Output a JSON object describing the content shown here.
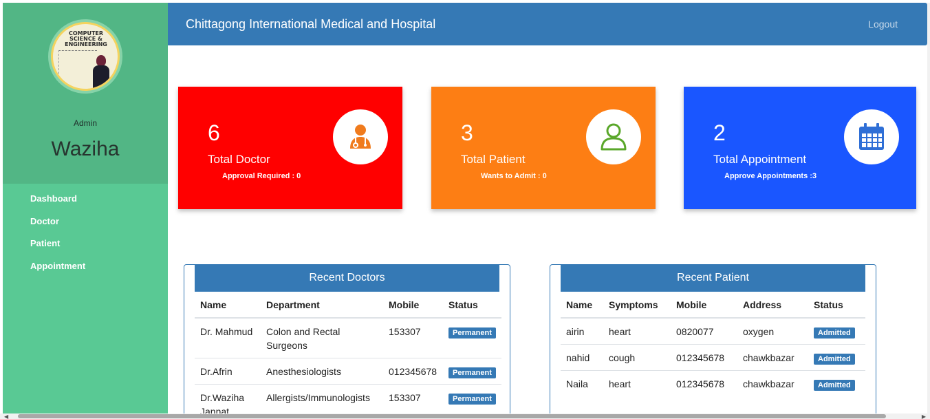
{
  "header": {
    "title": "Chittagong International Medical and Hospital",
    "logout_label": "Logout",
    "color": "#3579b5"
  },
  "sidebar": {
    "role": "Admin",
    "user_name": "Waziha",
    "avatar_text": "COMPUTER SCIENCE & ENGINEERING",
    "items": [
      {
        "label": "Dashboard"
      },
      {
        "label": "Doctor"
      },
      {
        "label": "Patient"
      },
      {
        "label": "Appointment"
      }
    ]
  },
  "cards": [
    {
      "value": "6",
      "label": "Total Doctor",
      "sub": "Approval Required : 0",
      "color": "#ff0000",
      "icon": "doctor-icon"
    },
    {
      "value": "3",
      "label": "Total Patient",
      "sub": "Wants to Admit : 0",
      "color": "#fd7e14",
      "icon": "user-icon"
    },
    {
      "value": "2",
      "label": "Total Appointment",
      "sub": "Approve Appointments :3",
      "color": "#1a56ff",
      "icon": "calendar-icon"
    }
  ],
  "recent_doctors": {
    "title": "Recent Doctors",
    "columns": [
      "Name",
      "Department",
      "Mobile",
      "Status"
    ],
    "rows": [
      {
        "name": "Dr. Mahmud",
        "department": "Colon and Rectal Surgeons",
        "mobile": "153307",
        "status": "Permanent"
      },
      {
        "name": "Dr.Afrin",
        "department": "Anesthesiologists",
        "mobile": "012345678",
        "status": "Permanent"
      },
      {
        "name": "Dr.Waziha Jannat",
        "department": "Allergists/Immunologists",
        "mobile": "153307",
        "status": "Permanent"
      }
    ]
  },
  "recent_patients": {
    "title": "Recent Patient",
    "columns": [
      "Name",
      "Symptoms",
      "Mobile",
      "Address",
      "Status"
    ],
    "rows": [
      {
        "name": "airin",
        "symptoms": "heart",
        "mobile": "0820077",
        "address": "oxygen",
        "status": "Admitted"
      },
      {
        "name": "nahid",
        "symptoms": "cough",
        "mobile": "012345678",
        "address": "chawkbazar",
        "status": "Admitted"
      },
      {
        "name": "Naila",
        "symptoms": "heart",
        "mobile": "012345678",
        "address": "chawkbazar",
        "status": "Admitted"
      }
    ]
  }
}
